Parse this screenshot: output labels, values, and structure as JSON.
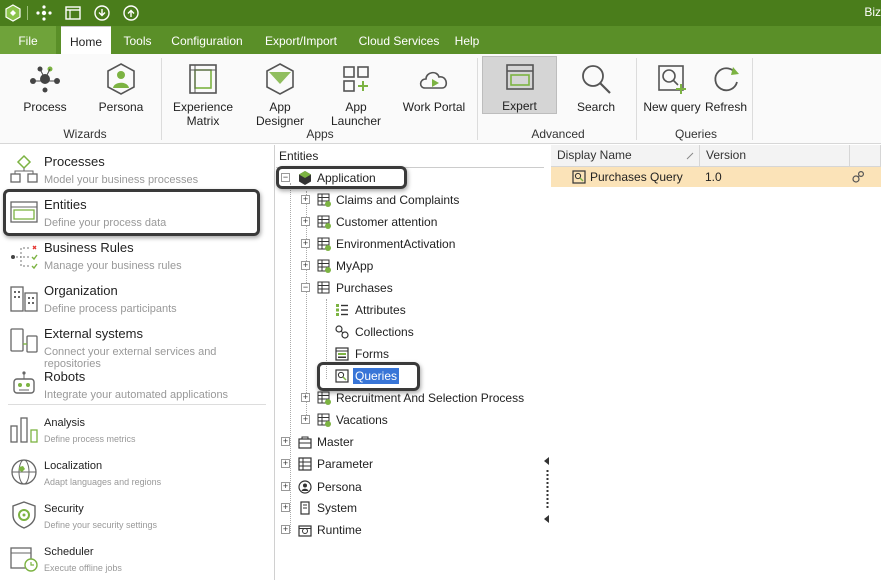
{
  "titlebar": {
    "title": "Biz"
  },
  "tabs": [
    {
      "label": "File"
    },
    {
      "label": "Home"
    },
    {
      "label": "Tools"
    },
    {
      "label": "Configuration"
    },
    {
      "label": "Export/Import"
    },
    {
      "label": "Cloud Services"
    },
    {
      "label": "Help"
    }
  ],
  "ribbon": {
    "buttons": [
      {
        "label": "Process",
        "icon": "process-icon"
      },
      {
        "label": "Persona",
        "icon": "persona-icon"
      },
      {
        "label": "Experience Matrix",
        "label1": "Experience",
        "label2": "Matrix",
        "icon": "experience-matrix-icon"
      },
      {
        "label": "App Designer",
        "icon": "app-designer-icon"
      },
      {
        "label": "App Launcher",
        "icon": "app-launcher-icon"
      },
      {
        "label": "Work Portal",
        "icon": "work-portal-icon"
      },
      {
        "label": "Expert",
        "icon": "expert-icon"
      },
      {
        "label": "Search",
        "icon": "search-icon"
      },
      {
        "label": "New query",
        "icon": "new-query-icon"
      },
      {
        "label": "Refresh",
        "icon": "refresh-icon"
      }
    ],
    "groups": [
      "Wizards",
      "Apps",
      "Advanced",
      "Queries"
    ]
  },
  "leftpanel": {
    "items": [
      {
        "title": "Processes",
        "subtitle": "Model your business processes"
      },
      {
        "title": "Entities",
        "subtitle": "Define your process data"
      },
      {
        "title": "Business Rules",
        "subtitle": "Manage your business rules"
      },
      {
        "title": "Organization",
        "subtitle": "Define process participants"
      },
      {
        "title": "External systems",
        "subtitle": "Connect your external services and repositories"
      },
      {
        "title": "Robots",
        "subtitle": "Integrate your automated applications"
      },
      {
        "title": "Analysis",
        "subtitle": "Define process metrics"
      },
      {
        "title": "Localization",
        "subtitle": "Adapt languages and regions"
      },
      {
        "title": "Security",
        "subtitle": "Define your security settings"
      },
      {
        "title": "Scheduler",
        "subtitle": "Execute offline jobs"
      }
    ]
  },
  "tree": {
    "header": "Entities",
    "nodes": [
      {
        "label": "Application"
      },
      {
        "label": "Claims and Complaints"
      },
      {
        "label": "Customer attention"
      },
      {
        "label": "EnvironmentActivation"
      },
      {
        "label": "MyApp"
      },
      {
        "label": "Purchases"
      },
      {
        "label": "Attributes"
      },
      {
        "label": "Collections"
      },
      {
        "label": "Forms"
      },
      {
        "label": "Queries"
      },
      {
        "label": "Recruitment And Selection Process"
      },
      {
        "label": "Vacations"
      },
      {
        "label": "Master"
      },
      {
        "label": "Parameter"
      },
      {
        "label": "Persona"
      },
      {
        "label": "System"
      },
      {
        "label": "Runtime"
      }
    ]
  },
  "grid": {
    "columns": [
      "Display Name",
      "Version"
    ],
    "rows": [
      {
        "name": "Purchases Query",
        "version": "1.0"
      }
    ]
  },
  "colors": {
    "brand": "#4a7d1b",
    "tabbar": "#5a8f28",
    "selected_row": "#fbe3b8",
    "accent_green": "#7cb342"
  }
}
